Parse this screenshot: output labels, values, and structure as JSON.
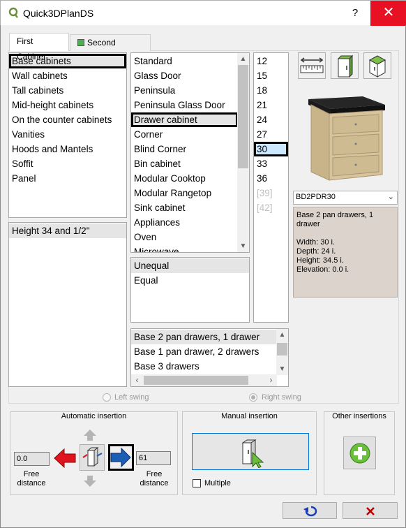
{
  "window": {
    "title": "Quick3DPlanDS",
    "help_label": "?",
    "close_label": "✕",
    "accent_red": "#e81123",
    "app_icon": "q-logo-icon"
  },
  "tabs": [
    {
      "label": "First Cabinet",
      "active": true
    },
    {
      "label": "Second Cabinet",
      "active": false,
      "icon": "green-square-icon"
    }
  ],
  "categories": {
    "items": [
      "Base cabinets",
      "Wall cabinets",
      "Tall cabinets",
      "Mid-height cabinets",
      "On the counter cabinets",
      "Vanities",
      "Hoods and Mantels",
      "Soffit",
      "Panel"
    ],
    "selected": "Base cabinets"
  },
  "heights": {
    "items": [
      "Height 34 and 1/2''"
    ],
    "selected": "Height 34 and 1/2''"
  },
  "types": {
    "items": [
      "Standard",
      "Glass Door",
      "Peninsula",
      "Peninsula Glass Door",
      "Drawer cabinet",
      "Corner",
      "Blind Corner",
      "Bin cabinet",
      "Modular Cooktop",
      "Modular Rangetop",
      "Sink cabinet",
      "Appliances",
      "Oven",
      "Microwave"
    ],
    "selected": "Drawer cabinet"
  },
  "division": {
    "items": [
      "Unequal",
      "Equal"
    ],
    "selected": "Unequal"
  },
  "widths": {
    "items": [
      "12",
      "15",
      "18",
      "21",
      "24",
      "27",
      "30",
      "33",
      "36",
      "[39]",
      "[42]"
    ],
    "selected": "30",
    "disabled": [
      "[39]",
      "[42]"
    ]
  },
  "configurations": {
    "items": [
      "Base 2 pan drawers, 1 drawer",
      "Base 1 pan drawer, 2 drawers",
      "Base 3 drawers"
    ],
    "selected": "Base 2 pan drawers, 1 drawer"
  },
  "view_buttons": [
    {
      "name": "dimension-ruler-icon"
    },
    {
      "name": "cabinet-front-view-icon"
    },
    {
      "name": "cabinet-top-view-icon"
    }
  ],
  "preview": {
    "code": "BD2PDR30",
    "description": "Base 2 pan drawers, 1 drawer",
    "width": "Width: 30 i.",
    "depth": "Depth: 24 i.",
    "height": "Height: 34.5 i.",
    "elevation": "Elevation: 0.0 i.",
    "info_bg": "#dcd3cc"
  },
  "swing": {
    "left_label": "Left swing",
    "right_label": "Right swing",
    "selected": "right"
  },
  "auto_insertion": {
    "title": "Automatic insertion",
    "left_distance": "0.0",
    "right_distance": "61",
    "free_distance_label": "Free distance",
    "arrow_left_color": "#e0141e",
    "arrow_right_color": "#1a5fb4"
  },
  "manual_insertion": {
    "title": "Manual insertion",
    "multiple_label": "Multiple",
    "multiple_checked": false
  },
  "other_insertions": {
    "title": "Other insertions",
    "add_color": "#6abf3a"
  },
  "footer": {
    "undo_icon": "undo-arrow-icon",
    "cancel_icon": "red-x-icon"
  }
}
